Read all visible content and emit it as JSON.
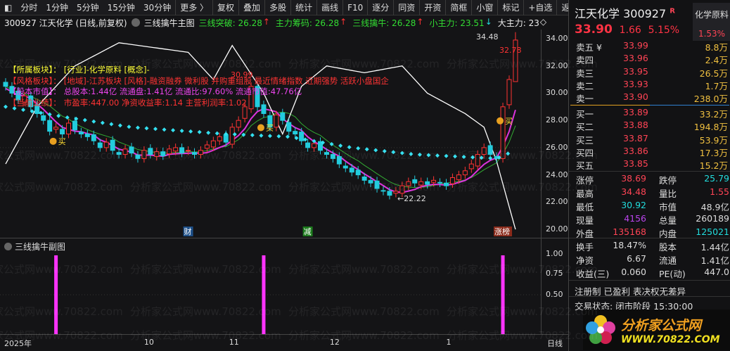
{
  "toolbar": {
    "items": [
      "分时",
      "1分钟",
      "5分钟",
      "15分钟",
      "30分钟",
      "更多 〉",
      "复权",
      "叠加",
      "多股",
      "统计",
      "画线",
      "F10",
      "逐分",
      "同资",
      "开资",
      "简框",
      "小窗",
      "标记",
      "+自选",
      "返回"
    ]
  },
  "infobar": {
    "title": "300927 江天化学 (日线,前复权)",
    "indicator": "三线擒牛主图",
    "values": [
      {
        "label": "三线突破: 26.28",
        "arrow": "↑"
      },
      {
        "label": "主力筹码: 26.28",
        "arrow": "↑"
      },
      {
        "label": "三线擒牛: 26.28",
        "arrow": "↑"
      },
      {
        "label": "小主力: 23.51",
        "arrow": "↓"
      },
      {
        "label": "大主力: 23",
        "arrow": "◇"
      }
    ]
  },
  "overlay": [
    {
      "key": "【所属板块】：",
      "val": "[行业]-化学原料 [概念]-"
    },
    {
      "key": "【风格板块】：",
      "val": "[地域]-江苏板块 [风格]-融资融券 微利股 并购重组股 最近情绪指数 近期强势 活跃小盘国企"
    },
    {
      "key": "【股本市值】：",
      "val": "总股本:1.44亿 流通盘:1.41亿 流通比:97.60% 流通市值:47.76亿"
    },
    {
      "key": "【当前业绩】：",
      "val": "市盈率:447.00 净资收益率:1.14 主营利润率:1.02"
    }
  ],
  "watermark": "分析家公式网www.70822.com",
  "chart_data": {
    "type": "candlestick",
    "price_axis": [
      "34.00",
      "32.00",
      "30.00",
      "28.00",
      "26.00",
      "24.00",
      "22.00",
      "20.00"
    ],
    "ylim": [
      20,
      34
    ],
    "closes": [
      30.5,
      30,
      29.5,
      29.8,
      29,
      28.5,
      28,
      27.2,
      27.5,
      27,
      27.8,
      27.3,
      27,
      26.8,
      26.5,
      26,
      26.4,
      25.8,
      25.5,
      25.9,
      25.6,
      25.2,
      25.8,
      25.5,
      25.7,
      25.4,
      25.9,
      26,
      25.6,
      25.8,
      25.5,
      25.8,
      26.2,
      26.5,
      26.8,
      26.4,
      27.5,
      28,
      29,
      30.5,
      29,
      28.5,
      27.5,
      28.4,
      28,
      27.2,
      27,
      26.5,
      26,
      26.3,
      25.8,
      25.5,
      25.2,
      24.8,
      24.5,
      24.2,
      24,
      23.6,
      23.4,
      23,
      22.8,
      22.5,
      22.8,
      23.2,
      23.5,
      23.4,
      23.5,
      23.3,
      23.6,
      23.4,
      23.2,
      23.8,
      24,
      24.3,
      24.8,
      25.5,
      26,
      25.5,
      25.2,
      29,
      31,
      33.9
    ],
    "white_line": [
      [
        0,
        24.8
      ],
      [
        5,
        29
      ],
      [
        11,
        32
      ],
      [
        18,
        33.7
      ],
      [
        29,
        33
      ],
      [
        33,
        31
      ],
      [
        36,
        33.5
      ],
      [
        41,
        30
      ],
      [
        44,
        27
      ],
      [
        47,
        30.5
      ],
      [
        51,
        32
      ],
      [
        57,
        31.5
      ],
      [
        63,
        32
      ],
      [
        67,
        30
      ],
      [
        73,
        28.5
      ],
      [
        76,
        27.5
      ],
      [
        78,
        25
      ],
      [
        81,
        20
      ]
    ],
    "cyan_line": [
      [
        0,
        29
      ],
      [
        10,
        28.2
      ],
      [
        20,
        27.5
      ],
      [
        35,
        27
      ],
      [
        45,
        26.8
      ],
      [
        55,
        26
      ],
      [
        65,
        25.5
      ],
      [
        78,
        25.2
      ],
      [
        81,
        25.8
      ]
    ],
    "annotations": {
      "high": "34.48",
      "high2": "32.78",
      "peak": "30.99",
      "low": "22.22",
      "buy": "买"
    },
    "events": [
      {
        "label": "财",
        "idx": 29,
        "color": "#1d4f88"
      },
      {
        "label": "减",
        "idx": 48,
        "color": "#1c7a1c"
      },
      {
        "label": "涨榜",
        "idx": 79,
        "color": "#8a2a1a"
      }
    ],
    "sub": {
      "title": "三线擒牛副图",
      "axis": [
        "1.00",
        "0.75",
        "0.50"
      ],
      "signals": [
        8,
        41,
        79
      ]
    },
    "months": [
      {
        "label": "2025年",
        "idx": 0
      },
      {
        "label": "10",
        "idx": 22
      },
      {
        "label": "11",
        "idx": 35.5
      },
      {
        "label": "12",
        "idx": 51.5
      },
      {
        "label": "1",
        "idx": 70
      }
    ],
    "period": "日线"
  },
  "right": {
    "name": "江天化学 300927",
    "r": "R",
    "sector": "化学原料",
    "sector_pct": "1.53%",
    "price": "33.90",
    "chg": "1.66",
    "pct": "5.15%",
    "asks": [
      [
        "卖五 ¥",
        "33.99",
        "8.8万"
      ],
      [
        "卖四",
        "33.96",
        "2.4万"
      ],
      [
        "卖三",
        "33.95",
        "26.5万"
      ],
      [
        "卖二",
        "33.93",
        "1.7万"
      ],
      [
        "卖一",
        "33.90",
        "238.0万"
      ]
    ],
    "bids": [
      [
        "买一",
        "33.89",
        "33.2万"
      ],
      [
        "买二",
        "33.88",
        "194.8万"
      ],
      [
        "买三",
        "33.87",
        "53.9万"
      ],
      [
        "买四",
        "33.86",
        "17.3万"
      ],
      [
        "买五",
        "33.85",
        "15.2万"
      ]
    ],
    "stats": [
      [
        "涨停",
        "38.69",
        "#ff4455",
        "跌停",
        "25.79",
        "#22dddd"
      ],
      [
        "最高",
        "34.48",
        "#ff4455",
        "量比",
        "1.55",
        "#ff4455"
      ],
      [
        "最低",
        "30.92",
        "#22dddd",
        "市值",
        "48.9亿",
        "#ddd"
      ],
      [
        "现量",
        "4156",
        "#bb44ee",
        "总量",
        "260189",
        "#ddd"
      ],
      [
        "外盘",
        "135168",
        "#ff4455",
        "内盘",
        "125021",
        "#22dddd"
      ]
    ],
    "stats2": [
      [
        "换手",
        "18.47%",
        "股本",
        "1.44亿"
      ],
      [
        "净资",
        "6.67",
        "流通",
        "1.41亿"
      ],
      [
        "收益(三)",
        "0.060",
        "PE(动)",
        "447.0"
      ]
    ],
    "tags": "注册制 已盈利 表决权无差异",
    "status": "交易状态: 闭市阶段 15:30:00",
    "logo": {
      "cn": "分析家公式网",
      "url": "WWW.70822.COM"
    }
  }
}
